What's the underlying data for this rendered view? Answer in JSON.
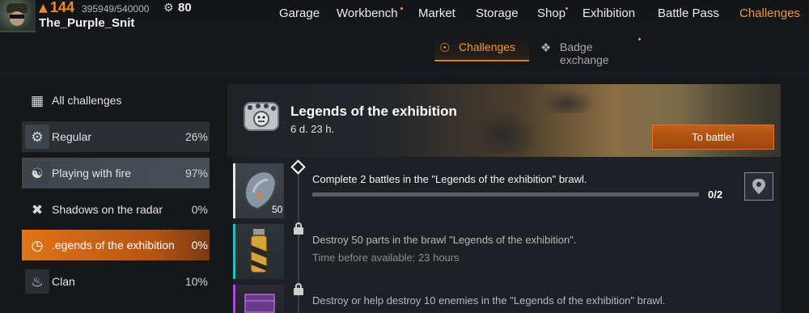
{
  "player": {
    "level": "144",
    "xp": "395949/540000",
    "pvp_rank": "80",
    "username": "The_Purple_Snit"
  },
  "nav": {
    "items": [
      {
        "label": "Garage",
        "active": false,
        "dot": false
      },
      {
        "label": "Workbench",
        "active": false,
        "dot": true
      },
      {
        "label": "Market",
        "active": false,
        "dot": false
      },
      {
        "label": "Storage",
        "active": false,
        "dot": false
      },
      {
        "label": "Shop",
        "active": false,
        "dot": true
      },
      {
        "label": "Exhibition",
        "active": false,
        "dot": false
      },
      {
        "label": "Battle Pass",
        "active": false,
        "dot": false
      },
      {
        "label": "Challenges",
        "active": true,
        "dot": false
      }
    ]
  },
  "subtabs": {
    "challenges": "Challenges",
    "badge_exchange": "Badge exchange"
  },
  "sidebar": {
    "all_label": "All challenges",
    "items": [
      {
        "label": "Regular",
        "pct": "26%"
      },
      {
        "label": "Playing with fire",
        "pct": "97%"
      },
      {
        "label": "Shadows on the radar",
        "pct": "0%"
      },
      {
        "label": ".egends of the exhibition",
        "pct": "0%"
      },
      {
        "label": "Clan",
        "pct": "10%"
      }
    ]
  },
  "banner": {
    "title": "Legends of the exhibition",
    "time_left": "6 d. 23 h.",
    "button": "To battle!"
  },
  "tasks": [
    {
      "text": "Complete 2 battles in the \"Legends of the exhibition\" brawl.",
      "reward_count": "50",
      "progress_text": "0/2",
      "progress_fraction": 0.0
    },
    {
      "text": "Destroy 50 parts in the brawl \"Legends of the exhibition\".",
      "sub": "Time before available: 23 hours"
    },
    {
      "text": "Destroy or help destroy 10 enemies in the \"Legends of the exhibition\" brawl."
    }
  ],
  "colors": {
    "accent": "#f0963c",
    "active_item": "#e27419",
    "background": "#15171b"
  }
}
